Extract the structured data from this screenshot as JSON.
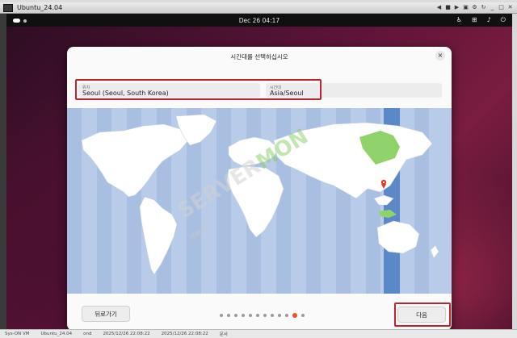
{
  "vm_window": {
    "title": "Ubuntu_24.04",
    "controls": [
      "◀",
      "■",
      "▶",
      "▣",
      "⚙",
      "↻",
      "_",
      "□",
      "✕"
    ]
  },
  "topbar": {
    "clock": "Dec 26  04:17",
    "icons": [
      "accessibility-icon",
      "network-icon",
      "volume-icon",
      "power-icon"
    ]
  },
  "dialog": {
    "title": "시간대를 선택하십시오",
    "close_label": "×",
    "location": {
      "label": "위치",
      "value": "Seoul (Seoul, South Korea)"
    },
    "timezone": {
      "label": "시간대",
      "value": "Asia/Seoul"
    },
    "back_button": "뒤로가기",
    "next_button": "다음",
    "page_count": 12,
    "active_page": 11
  },
  "watermark": {
    "main": "SERVER",
    "accent": "MON",
    "sub": "서버몬"
  },
  "taskbar": {
    "items": [
      "Sys-ON VM",
      "Ubuntu_24.04",
      "ond",
      "2025/12/26 22:08:22",
      "2025/12/26 22:08:22",
      "문서"
    ]
  },
  "colors": {
    "accent": "#e95420",
    "highlight": "#c0232b",
    "map_sea": "#b8cbe9",
    "selected_region": "#8fd36a"
  }
}
